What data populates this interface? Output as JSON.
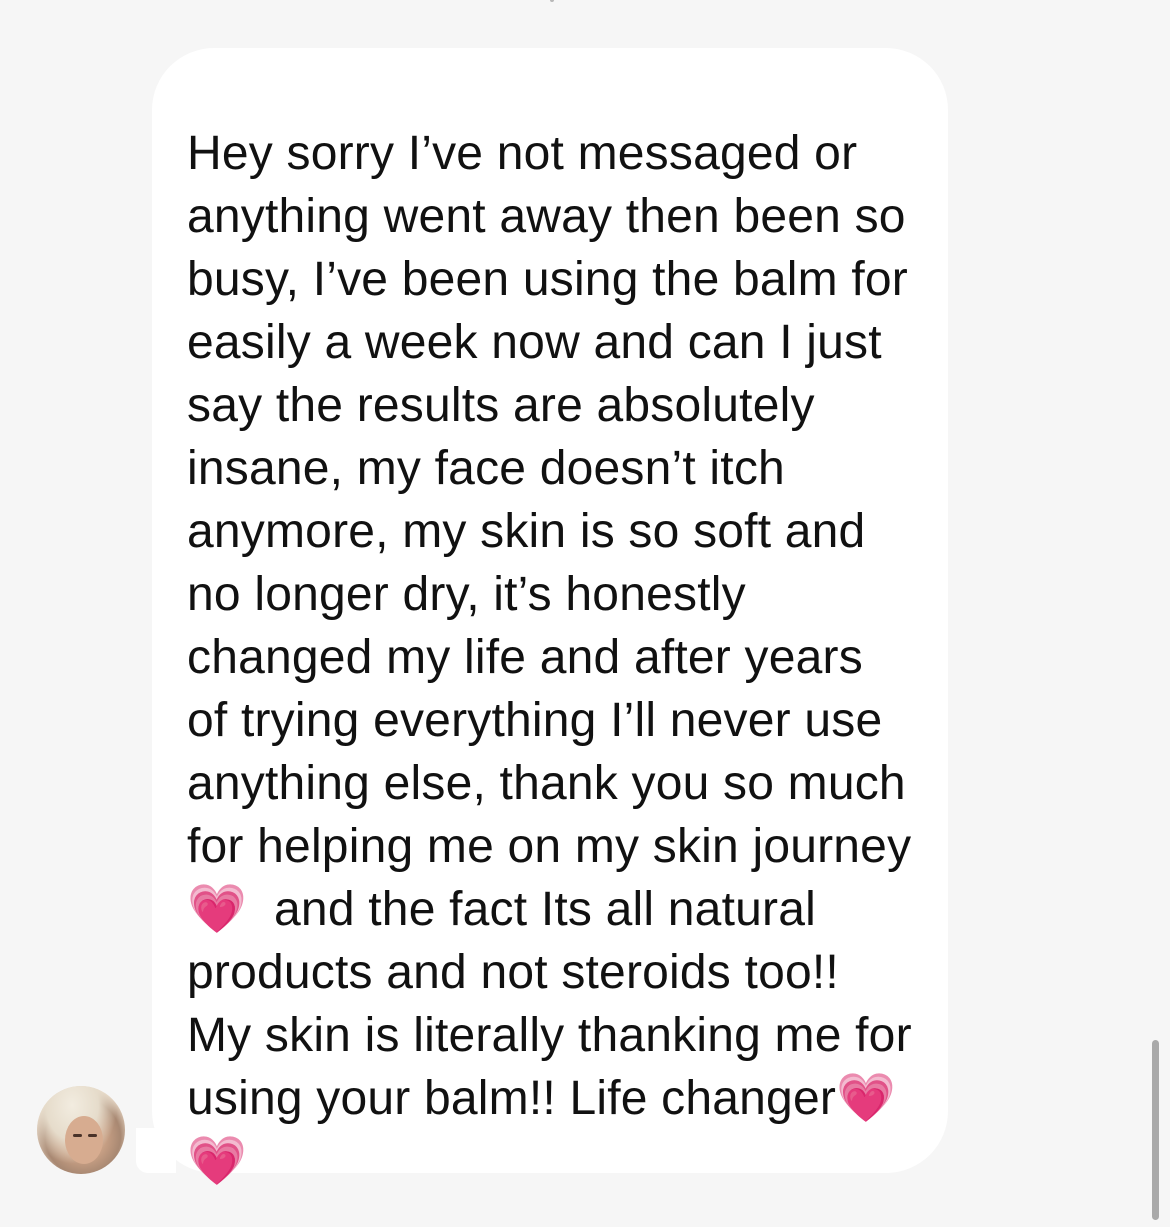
{
  "conversation": {
    "message": {
      "lines": [
        "Hey sorry I’ve not messaged or",
        "anything went away then been so",
        "busy, I’ve been using the balm for",
        "easily a week now and can I just",
        "say the results are absolutely",
        "insane, my face doesn’t itch",
        "anymore, my skin is so soft and",
        "no longer dry, it’s honestly",
        "changed my life and after years",
        "of trying everything I’ll never use",
        "anything else, thank you so much",
        "for helping me on my skin journey",
        "💗  and the fact Its all natural",
        "products and not steroids too!!",
        "My skin is literally thanking me for",
        "using your balm!! Life changer💗",
        "💗"
      ]
    },
    "sender": {
      "avatar": "avatar-photo"
    },
    "colors": {
      "background": "#f6f6f6",
      "bubble": "#ffffff",
      "text": "#111111",
      "heart": "#ff2e9a"
    }
  }
}
